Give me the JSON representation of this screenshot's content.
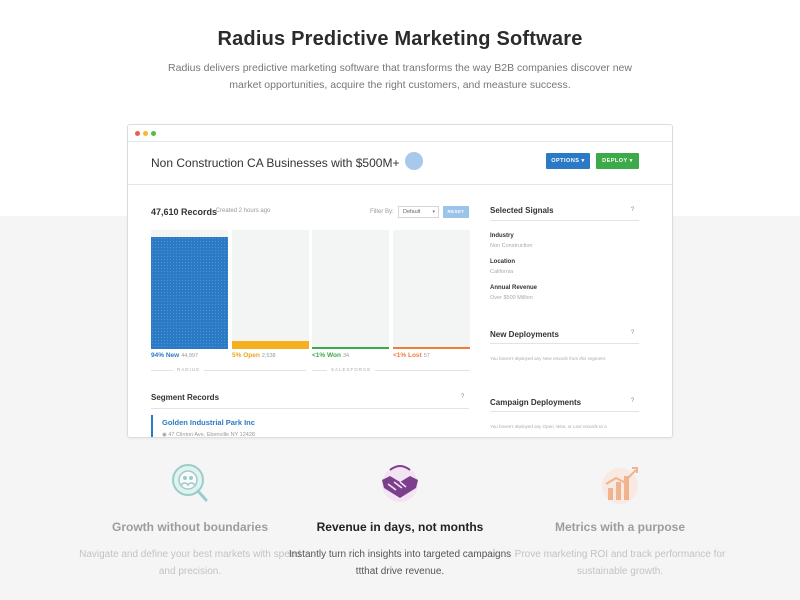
{
  "hero": {
    "title": "Radius Predictive Marketing Software",
    "subtitle": "Radius delivers predictive marketing software that transforms the way B2B companies discover new market opportunities, acquire the right customers, and measture success."
  },
  "app": {
    "segment_title": "Non Construction CA Businesses with $500M+",
    "options_button": "OPTIONS ▾",
    "deploy_button": "DEPLOY ▾",
    "records_count": "47,610 Records",
    "records_created": "· Created 2 hours ago",
    "filter_label": "Filter By:",
    "filter_value": "Default",
    "reset_button": "RESET",
    "bars": [
      {
        "pct": "94% New",
        "count": "44,997",
        "fraction": 0.94,
        "color": "#2a7ac6",
        "label_color": "#2a7ac6"
      },
      {
        "pct": "5% Open",
        "count": "2,538",
        "fraction": 0.05,
        "color": "#f5b022",
        "label_color": "#f0a21b"
      },
      {
        "pct": "<1% Won",
        "count": "34",
        "fraction": 0.0,
        "color": "#3caa48",
        "label_color": "#3caa48"
      },
      {
        "pct": "<1% Lost",
        "count": "57",
        "fraction": 0.0,
        "color": "#ef7d3a",
        "label_color": "#ef7d3a"
      }
    ],
    "group_radius": "RADIUS",
    "group_salesforce": "SALESFORCE",
    "segment_records_title": "Segment Records",
    "segment_record": {
      "name": "Golden Industrial Park Inc",
      "address": "◉ 47 Clinton Ave, Ebenville NY 12428"
    },
    "help": "?",
    "selected_signals_title": "Selected Signals",
    "signals": [
      {
        "label": "Industry",
        "value": "Non Construction"
      },
      {
        "label": "Location",
        "value": "California"
      },
      {
        "label": "Annual Revenue",
        "value": "Over $500 Million"
      }
    ],
    "new_deployments_title": "New Deployments",
    "new_deployments_note": "You haven't deployed any New records from this segment.",
    "campaign_deployments_title": "Campaign Deployments",
    "campaign_deployments_note": "You haven't deployed any Open, Won, or Lost records to a"
  },
  "features": [
    {
      "icon": "search-people-icon",
      "title": "Growth without boundaries",
      "desc": "Navigate and define your best markets with speed and precision."
    },
    {
      "icon": "handshake-icon",
      "title": "Revenue in days, not months",
      "desc": "Instantly turn rich insights into targeted campaigns ttthat drive revenue."
    },
    {
      "icon": "chart-growth-icon",
      "title": "Metrics with a purpose",
      "desc": "Prove marketing ROI and track performance for sustainable growth."
    }
  ],
  "colors": {
    "accent_blue": "#2a7ac6",
    "deploy_green": "#3caa48",
    "icon_purple": "#7c3f8e",
    "icon_teal": "#4fb0a8",
    "icon_orange": "#ef7d3a"
  }
}
